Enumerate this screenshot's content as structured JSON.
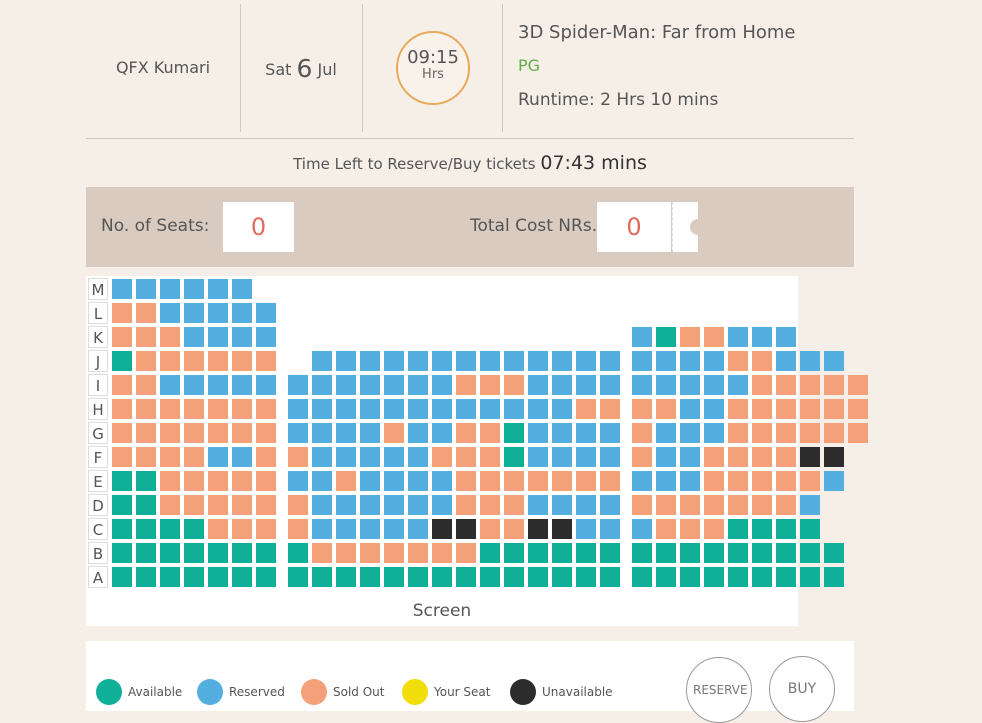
{
  "header": {
    "venue": "QFX Kumari",
    "date": {
      "weekday": "Sat",
      "day": "6",
      "month": "Jul"
    },
    "time": {
      "value": "09:15",
      "unit": "Hrs"
    },
    "movie": {
      "title": "3D Spider-Man: Far from Home",
      "rating": "PG",
      "runtime": "Runtime: 2 Hrs 10 mins"
    }
  },
  "timer": {
    "label": "Time Left to Reserve/Buy tickets",
    "value": "07:43 mins"
  },
  "summary": {
    "seats_label": "No. of Seats:",
    "seats_value": "0",
    "cost_label": "Total Cost NRs.",
    "cost_value": "0"
  },
  "seatmap": {
    "screen_label": "Screen",
    "rows": [
      {
        "label": "M",
        "seats": "rrrrrr"
      },
      {
        "label": "L",
        "seats": "ssrrrrr"
      },
      {
        "label": "K",
        "seats": "sssrrrr______________rassrrr"
      },
      {
        "label": "J",
        "seats": "assssss_rrrrrrrrrrrrrrrrrssrrr"
      },
      {
        "label": "I",
        "seats": "ssrrrrrrrrrrrrsssrrrrrrrrrsssss"
      },
      {
        "label": "H",
        "seats": "sssssssrrrrrrrrrrrrssssrrssssss"
      },
      {
        "label": "G",
        "seats": "sssssssrrrrsrrssarrrrsrrrssssss"
      },
      {
        "label": "F",
        "seats": "ssssrrssrrrrrsssarrrrsrrssssuu"
      },
      {
        "label": "E",
        "seats": "aasssssrrsrrrrsssssssrrrsssssr"
      },
      {
        "label": "D",
        "seats": "aassssssrrrrrrsssrrrrsssssssr"
      },
      {
        "label": "C",
        "seats": "aaaassssrrrrruussuurrrsssaaaa"
      },
      {
        "label": "B",
        "seats": "aaaaaaaasssssssaaaaaaaaaaaaaaa"
      },
      {
        "label": "A",
        "seats": "aaaaaaaaaaaaaaaaaaaaaaaaaaaaaa"
      }
    ]
  },
  "legend": [
    {
      "label": "Available",
      "color": "#0fb097"
    },
    {
      "label": "Reserved",
      "color": "#55aee0"
    },
    {
      "label": "Sold Out",
      "color": "#f4a078"
    },
    {
      "label": "Your Seat",
      "color": "#f0dd0a"
    },
    {
      "label": "Unavailable",
      "color": "#2c2c2c"
    }
  ],
  "actions": {
    "reserve": "RESERVE",
    "buy": "BUY"
  }
}
